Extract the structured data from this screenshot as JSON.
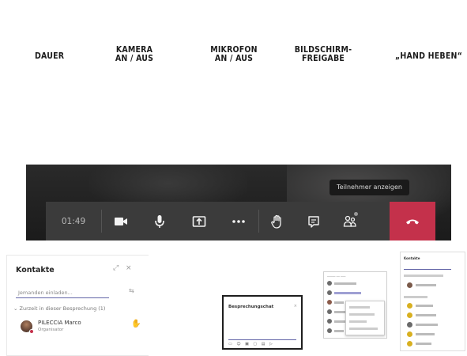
{
  "headings": {
    "dauer": "DAUER",
    "kamera": "KAMERA\nAN / AUS",
    "mikrofon": "MIKROFON\nAN / AUS",
    "bildschirm": "BILDSCHIRM-\nFREIGABE",
    "hand": "„HAND HEBEN“"
  },
  "toolbar": {
    "duration": "01:49",
    "tooltip": "Teilnehmer anzeigen",
    "buttons": [
      {
        "name": "camera-button",
        "icon": "video-camera-icon"
      },
      {
        "name": "microphone-button",
        "icon": "microphone-icon"
      },
      {
        "name": "share-screen-button",
        "icon": "share-screen-icon"
      },
      {
        "name": "more-options-button",
        "icon": "more-dots-icon"
      },
      {
        "name": "raise-hand-button",
        "icon": "hand-icon"
      },
      {
        "name": "chat-button",
        "icon": "chat-icon"
      },
      {
        "name": "participants-button",
        "icon": "participants-icon"
      },
      {
        "name": "hang-up-button",
        "icon": "hang-up-icon"
      }
    ],
    "hangup_color": "#c4314b",
    "bar_color": "#3b3b3b"
  },
  "kontakte": {
    "title": "Kontakte",
    "search_placeholder": "Jemanden einladen...",
    "section": "Zurzeit in dieser Besprechung (1)",
    "participant_name": "PILECCIA Marco",
    "participant_role": "Organisator"
  },
  "chat_thumb": {
    "title": "Besprechungschat"
  },
  "panel_thumb": {
    "title": "Kontakte"
  }
}
